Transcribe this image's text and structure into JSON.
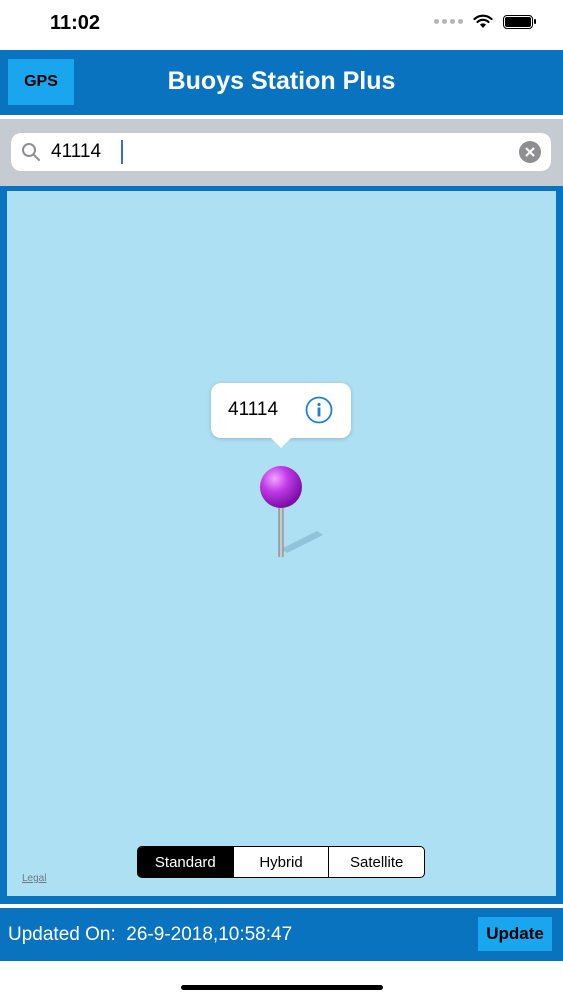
{
  "status_bar": {
    "time": "11:02",
    "icons": [
      "signal-dots-icon",
      "wifi-icon",
      "battery-icon"
    ],
    "battery_level": 1.0
  },
  "header": {
    "gps_label": "GPS",
    "title": "Buoys Station Plus"
  },
  "search": {
    "value": "41114",
    "icons": [
      "search-icon",
      "clear-icon"
    ]
  },
  "map": {
    "callout_title": "41114",
    "callout_icon": "info-icon",
    "pin_icon": "map-pin-icon",
    "modes": [
      {
        "label": "Standard",
        "selected": true
      },
      {
        "label": "Hybrid",
        "selected": false
      },
      {
        "label": "Satellite",
        "selected": false
      }
    ],
    "legal_label": "Legal"
  },
  "footer": {
    "updated_text": "Updated On:  26-9-2018,10:58:47",
    "update_label": "Update"
  },
  "colors": {
    "nav_blue": "#0a73c0",
    "button_blue": "#1aa6ee",
    "map_water": "#ade0f3",
    "pin_magenta": "#b33ae0"
  }
}
